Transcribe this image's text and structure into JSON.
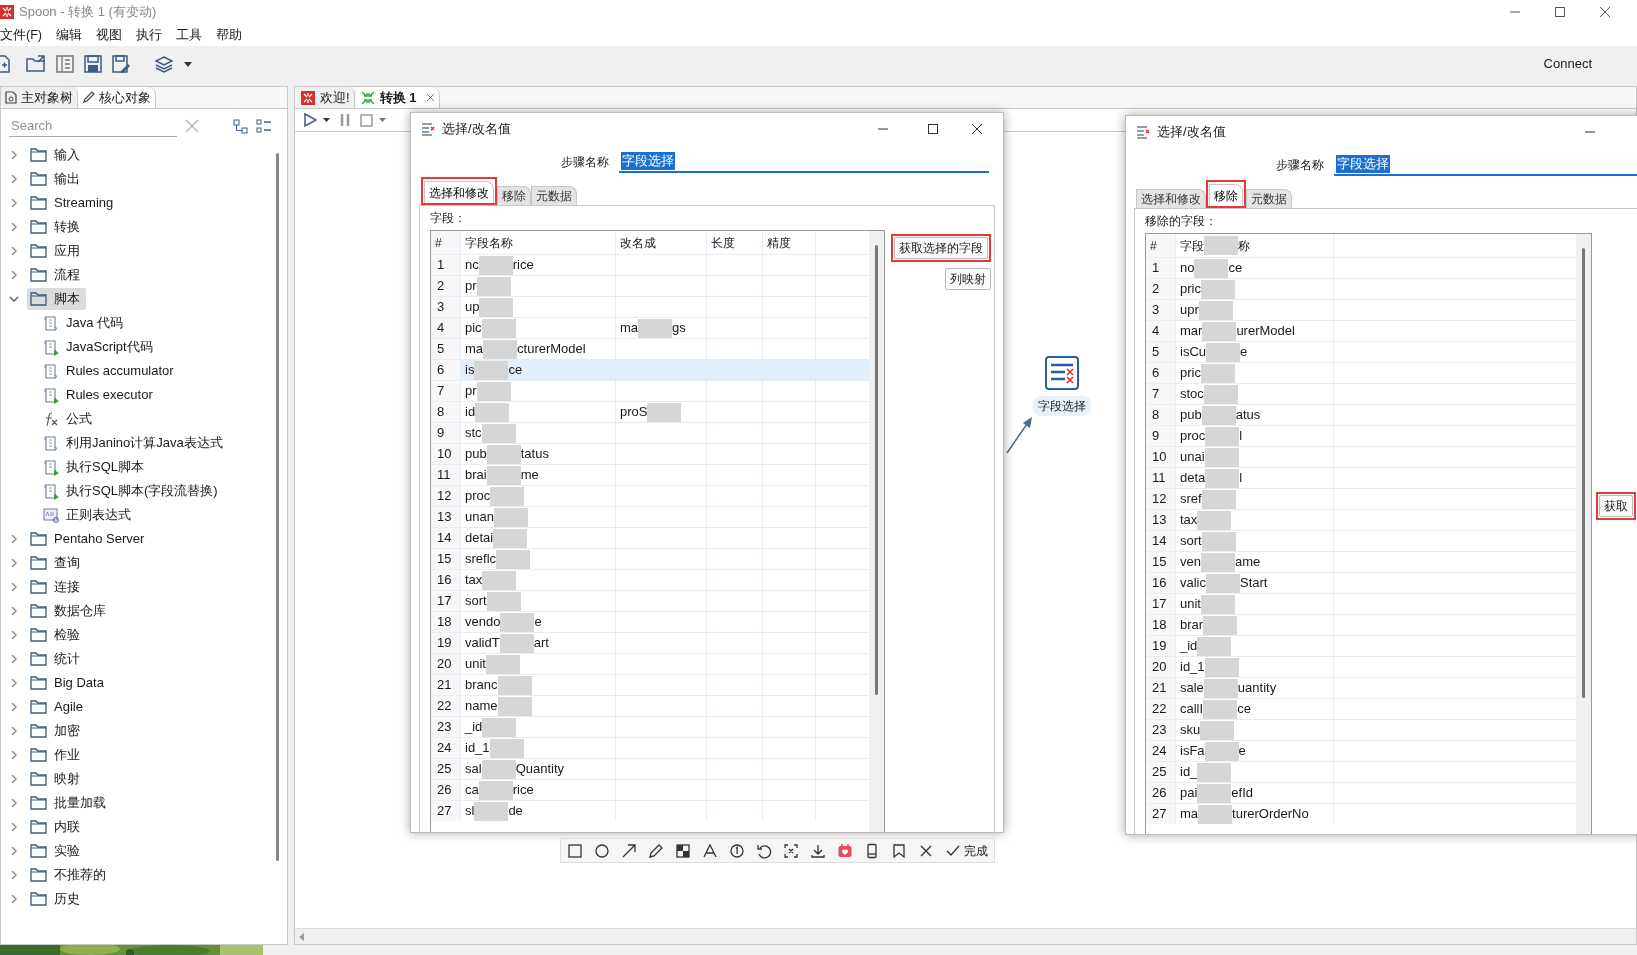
{
  "window": {
    "title": "Spoon - 转换 1 (有变动)",
    "connect": "Connect"
  },
  "menu": [
    "文件(F)",
    "编辑",
    "视图",
    "执行",
    "工具",
    "帮助"
  ],
  "left_panel": {
    "tabs": [
      {
        "label": "主对象树",
        "selected": false,
        "kind": "tree"
      },
      {
        "label": "核心对象",
        "selected": true,
        "kind": "pencil"
      }
    ],
    "search": {
      "placeholder": "Search"
    },
    "tree": [
      {
        "label": "输入",
        "expanded": false,
        "selected": false
      },
      {
        "label": "输出",
        "expanded": false,
        "selected": false
      },
      {
        "label": "Streaming",
        "expanded": false,
        "selected": false
      },
      {
        "label": "转换",
        "expanded": false,
        "selected": false
      },
      {
        "label": "应用",
        "expanded": false,
        "selected": false
      },
      {
        "label": "流程",
        "expanded": false,
        "selected": false
      },
      {
        "label": "脚本",
        "expanded": true,
        "selected": true,
        "children": [
          {
            "label": "Java 代码",
            "kind": "script"
          },
          {
            "label": "JavaScript代码",
            "kind": "script-run"
          },
          {
            "label": "Rules accumulator",
            "kind": "script"
          },
          {
            "label": "Rules executor",
            "kind": "script-run"
          },
          {
            "label": "公式",
            "kind": "formula"
          },
          {
            "label": "利用Janino计算Java表达式",
            "kind": "script"
          },
          {
            "label": "执行SQL脚本",
            "kind": "script-run"
          },
          {
            "label": "执行SQL脚本(字段流替换)",
            "kind": "script-run"
          },
          {
            "label": "正则表达式",
            "kind": "regex"
          }
        ]
      },
      {
        "label": "Pentaho Server",
        "expanded": false,
        "selected": false
      },
      {
        "label": "查询",
        "expanded": false,
        "selected": false
      },
      {
        "label": "连接",
        "expanded": false,
        "selected": false
      },
      {
        "label": "数据仓库",
        "expanded": false,
        "selected": false
      },
      {
        "label": "检验",
        "expanded": false,
        "selected": false
      },
      {
        "label": "统计",
        "expanded": false,
        "selected": false
      },
      {
        "label": "Big Data",
        "expanded": false,
        "selected": false
      },
      {
        "label": "Agile",
        "expanded": false,
        "selected": false
      },
      {
        "label": "加密",
        "expanded": false,
        "selected": false
      },
      {
        "label": "作业",
        "expanded": false,
        "selected": false
      },
      {
        "label": "映射",
        "expanded": false,
        "selected": false
      },
      {
        "label": "批量加载",
        "expanded": false,
        "selected": false
      },
      {
        "label": "内联",
        "expanded": false,
        "selected": false
      },
      {
        "label": "实验",
        "expanded": false,
        "selected": false
      },
      {
        "label": "不推荐的",
        "expanded": false,
        "selected": false
      },
      {
        "label": "历史",
        "expanded": false,
        "selected": false
      }
    ]
  },
  "editor_tabs": [
    {
      "label": "欢迎!",
      "selected": false,
      "kind": "welcome"
    },
    {
      "label": "转换 1",
      "selected": true,
      "kind": "transform"
    }
  ],
  "canvas": {
    "node": {
      "label": "字段选择"
    }
  },
  "dialogs": [
    {
      "title": "选择/改名值",
      "step_name_label": "步骤名称",
      "step_name": "字段选择",
      "tabs": [
        {
          "label": "选择和修改",
          "selected": true,
          "highlighted": true
        },
        {
          "label": "移除",
          "selected": false,
          "highlighted": false
        },
        {
          "label": "元数据",
          "selected": false,
          "highlighted": false
        }
      ],
      "fields_label": "字段：",
      "columns": [
        [
          "#"
        ],
        [
          "字段名称"
        ],
        [
          "改名成"
        ],
        [
          "长度"
        ],
        [
          "精度"
        ]
      ],
      "rows": [
        {
          "n": "1",
          "name": [
            "nc",
            "rice"
          ],
          "rename": [],
          "selected": false
        },
        {
          "n": "2",
          "name": [
            "pr"
          ],
          "rename": [],
          "selected": false
        },
        {
          "n": "3",
          "name": [
            "up"
          ],
          "rename": [],
          "selected": false
        },
        {
          "n": "4",
          "name": [
            "pic"
          ],
          "rename": [
            "ma",
            "gs"
          ],
          "selected": false
        },
        {
          "n": "5",
          "name": [
            "ma",
            "cturerModel"
          ],
          "rename": [],
          "selected": false
        },
        {
          "n": "6",
          "name": [
            "is",
            "ce"
          ],
          "rename": [],
          "selected": true
        },
        {
          "n": "7",
          "name": [
            "pr"
          ],
          "rename": [],
          "selected": false
        },
        {
          "n": "8",
          "name": [
            "id"
          ],
          "rename": [
            "proS"
          ],
          "selected": false
        },
        {
          "n": "9",
          "name": [
            "stc"
          ],
          "rename": [],
          "selected": false
        },
        {
          "n": "10",
          "name": [
            "pub",
            "tatus"
          ],
          "rename": [],
          "selected": false
        },
        {
          "n": "11",
          "name": [
            "brai",
            "me"
          ],
          "rename": [],
          "selected": false
        },
        {
          "n": "12",
          "name": [
            "proc"
          ],
          "rename": [],
          "selected": false
        },
        {
          "n": "13",
          "name": [
            "unan"
          ],
          "rename": [],
          "selected": false
        },
        {
          "n": "14",
          "name": [
            "detai"
          ],
          "rename": [],
          "selected": false
        },
        {
          "n": "15",
          "name": [
            "sreflc"
          ],
          "rename": [],
          "selected": false
        },
        {
          "n": "16",
          "name": [
            "tax"
          ],
          "rename": [],
          "selected": false
        },
        {
          "n": "17",
          "name": [
            "sort"
          ],
          "rename": [],
          "selected": false
        },
        {
          "n": "18",
          "name": [
            "vendo",
            "e"
          ],
          "rename": [],
          "selected": false
        },
        {
          "n": "19",
          "name": [
            "validT",
            "art"
          ],
          "rename": [],
          "selected": false
        },
        {
          "n": "20",
          "name": [
            "unit"
          ],
          "rename": [],
          "selected": false
        },
        {
          "n": "21",
          "name": [
            "branc"
          ],
          "rename": [],
          "selected": false
        },
        {
          "n": "22",
          "name": [
            "name"
          ],
          "rename": [],
          "selected": false
        },
        {
          "n": "23",
          "name": [
            "_id"
          ],
          "rename": [],
          "selected": false
        },
        {
          "n": "24",
          "name": [
            "id_1"
          ],
          "rename": [],
          "selected": false
        },
        {
          "n": "25",
          "name": [
            "sal",
            "Quantity"
          ],
          "rename": [],
          "selected": false
        },
        {
          "n": "26",
          "name": [
            "ca",
            "rice"
          ],
          "rename": [],
          "selected": false
        },
        {
          "n": "27",
          "name": [
            "sl",
            "de"
          ],
          "rename": [],
          "selected": false
        }
      ],
      "buttons": [
        {
          "label": "获取选择的字段",
          "highlighted": true
        },
        {
          "label": "列映射",
          "highlighted": false
        }
      ]
    },
    {
      "title": "选择/改名值",
      "step_name_label": "步骤名称",
      "step_name": "字段选择",
      "tabs": [
        {
          "label": "选择和修改",
          "selected": false,
          "highlighted": false
        },
        {
          "label": "移除",
          "selected": true,
          "highlighted": true
        },
        {
          "label": "元数据",
          "selected": false,
          "highlighted": false
        }
      ],
      "fields_label": "移除的字段：",
      "columns": [
        [
          "#"
        ],
        [
          "字段",
          "称"
        ]
      ],
      "rows": [
        {
          "n": "1",
          "name": [
            "no",
            "ce"
          ],
          "selected": false
        },
        {
          "n": "2",
          "name": [
            "pric"
          ],
          "selected": false
        },
        {
          "n": "3",
          "name": [
            "upr"
          ],
          "selected": false
        },
        {
          "n": "4",
          "name": [
            "mar",
            "urerModel"
          ],
          "selected": false
        },
        {
          "n": "5",
          "name": [
            "isCu",
            "e"
          ],
          "selected": false
        },
        {
          "n": "6",
          "name": [
            "pric"
          ],
          "selected": false
        },
        {
          "n": "7",
          "name": [
            "stoc"
          ],
          "selected": false
        },
        {
          "n": "8",
          "name": [
            "pub",
            "atus"
          ],
          "selected": false
        },
        {
          "n": "9",
          "name": [
            "proc",
            "l"
          ],
          "selected": false
        },
        {
          "n": "10",
          "name": [
            "unai"
          ],
          "selected": false
        },
        {
          "n": "11",
          "name": [
            "deta",
            "l"
          ],
          "selected": false
        },
        {
          "n": "12",
          "name": [
            "sref"
          ],
          "selected": false
        },
        {
          "n": "13",
          "name": [
            "tax"
          ],
          "selected": false
        },
        {
          "n": "14",
          "name": [
            "sort"
          ],
          "selected": false
        },
        {
          "n": "15",
          "name": [
            "ven",
            "ame"
          ],
          "selected": false
        },
        {
          "n": "16",
          "name": [
            "valic",
            "Start"
          ],
          "selected": false
        },
        {
          "n": "17",
          "name": [
            "unit"
          ],
          "selected": false
        },
        {
          "n": "18",
          "name": [
            "brar"
          ],
          "selected": false
        },
        {
          "n": "19",
          "name": [
            "_id"
          ],
          "selected": false
        },
        {
          "n": "20",
          "name": [
            "id_1"
          ],
          "selected": false
        },
        {
          "n": "21",
          "name": [
            "sale",
            "uantity"
          ],
          "selected": false
        },
        {
          "n": "22",
          "name": [
            "callI",
            "ce"
          ],
          "selected": false
        },
        {
          "n": "23",
          "name": [
            "sku"
          ],
          "selected": false
        },
        {
          "n": "24",
          "name": [
            "isFa",
            "e"
          ],
          "selected": false
        },
        {
          "n": "25",
          "name": [
            "id_"
          ],
          "selected": false
        },
        {
          "n": "26",
          "name": [
            "pai",
            "efId"
          ],
          "selected": false
        },
        {
          "n": "27",
          "name": [
            "ma",
            "turerOrderNo"
          ],
          "selected": false
        }
      ],
      "buttons": [
        {
          "label": "获取",
          "highlighted": true
        }
      ]
    }
  ],
  "annotation_toolbar": {
    "done": "完成"
  }
}
